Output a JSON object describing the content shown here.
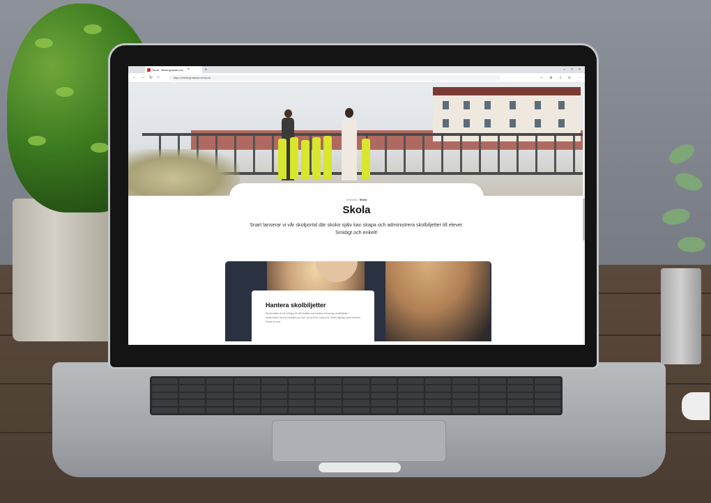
{
  "browser": {
    "tab_title": "Skola - Biletinghalland.se",
    "url": "https://biletinghalland.se/skola",
    "nav": {
      "back": "←",
      "forward": "→",
      "refresh": "↻",
      "home": "⌂"
    },
    "tab_close": "×",
    "new_tab": "+",
    "window_controls": [
      "–",
      "□",
      "×"
    ],
    "toolbar_icons": [
      "☆",
      "⊕",
      "⇩",
      "⊙",
      "⋯"
    ]
  },
  "page": {
    "breadcrumb_root": "Startsida",
    "breadcrumb_sep": "/",
    "breadcrumb_current": "Skola",
    "title": "Skola",
    "lead_line1": "Snart lanserar vi vår skolportal där skolor själv kan skapa och administrera skolbiljetter till elever.",
    "lead_line2": "Smidigt och enkelt!",
    "card": {
      "title": "Hantera skolbiljetter",
      "text": "Skolportalen är ett verktyg för att beställa och hantera elevernas skolbiljetter. I skolportalen kan du beställa nya kort, ta bort kort, byta kort, ändra biljettyp samt hantera förlust av kort."
    }
  },
  "colors": {
    "favicon": "#d72a2a",
    "page_bg": "#ffffff",
    "card_bg": "#2a3140"
  }
}
